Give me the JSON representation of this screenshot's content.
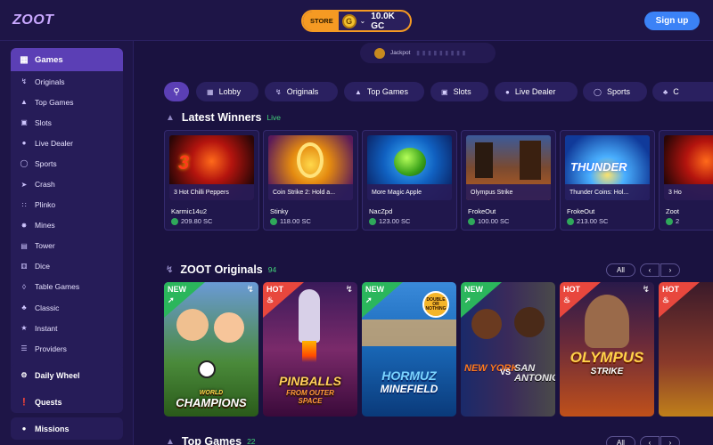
{
  "header": {
    "logo": "ZOOT",
    "store_label": "STORE",
    "coin_letter": "G",
    "balance": "10.0K GC",
    "signup_label": "Sign up"
  },
  "jackpot": {
    "label": "Jackpot"
  },
  "sidebar": {
    "games_label": "Games",
    "items": [
      {
        "label": "Originals",
        "icon": "bolt-icon"
      },
      {
        "label": "Top Games",
        "icon": "trophy-icon"
      },
      {
        "label": "Slots",
        "icon": "slots-icon"
      },
      {
        "label": "Live Dealer",
        "icon": "live-dealer-icon"
      },
      {
        "label": "Sports",
        "icon": "sports-icon"
      },
      {
        "label": "Crash",
        "icon": "rocket-icon"
      },
      {
        "label": "Plinko",
        "icon": "plinko-icon"
      },
      {
        "label": "Mines",
        "icon": "mine-icon"
      },
      {
        "label": "Tower",
        "icon": "tower-icon"
      },
      {
        "label": "Dice",
        "icon": "dice-icon"
      },
      {
        "label": "Table Games",
        "icon": "table-games-icon"
      },
      {
        "label": "Classic",
        "icon": "classic-icon"
      },
      {
        "label": "Instant",
        "icon": "instant-icon"
      },
      {
        "label": "Providers",
        "icon": "providers-icon"
      }
    ],
    "daily_wheel": "Daily Wheel",
    "quests": "Quests",
    "missions": "Missions"
  },
  "tabs": [
    {
      "label": "Lobby",
      "icon": "gamepad-icon"
    },
    {
      "label": "Originals",
      "icon": "bolt-icon"
    },
    {
      "label": "Top Games",
      "icon": "trophy-icon"
    },
    {
      "label": "Slots",
      "icon": "slots-icon"
    },
    {
      "label": "Live Dealer",
      "icon": "live-dealer-icon"
    },
    {
      "label": "Sports",
      "icon": "sports-icon"
    },
    {
      "label": "C",
      "icon": "classic-icon"
    }
  ],
  "latest_winners": {
    "title": "Latest Winners",
    "live_label": "Live",
    "cards": [
      {
        "game": "3 Hot Chilli Peppers",
        "user": "Karmic14u2",
        "amount": "209.80 SC"
      },
      {
        "game": "Coin Strike 2: Hold a...",
        "user": "Stinky",
        "amount": "118.00 SC"
      },
      {
        "game": "More Magic Apple",
        "user": "NacZpd",
        "amount": "123.00 SC"
      },
      {
        "game": "Olympus Strike",
        "user": "FrokeOut",
        "amount": "100.00 SC"
      },
      {
        "game": "Thunder Coins: Hol...",
        "user": "FrokeOut",
        "amount": "213.00 SC"
      },
      {
        "game": "3 Ho",
        "user": "Zoot",
        "amount": "2"
      }
    ]
  },
  "originals": {
    "title": "ZOOT Originals",
    "count": "94",
    "all_label": "All",
    "prev_icon": "‹",
    "next_icon": "›",
    "cards": [
      {
        "badge": "NEW",
        "title_lines": [
          "WORLD",
          "CHAMPIONS"
        ]
      },
      {
        "badge": "HOT",
        "title_lines": [
          "PINBALLS",
          "FROM OUTER SPACE"
        ]
      },
      {
        "badge": "NEW",
        "title_lines": [
          "DOUBLE OR NOTHING",
          "HORMUZ",
          "MINEFIELD"
        ]
      },
      {
        "badge": "NEW",
        "title_lines": [
          "NEW YORK",
          "VS",
          "SAN ANTONIO"
        ]
      },
      {
        "badge": "HOT",
        "title_lines": [
          "OLYMPUS",
          "STRIKE"
        ]
      },
      {
        "badge": "HOT",
        "title_lines": [
          ""
        ]
      }
    ]
  },
  "top_games": {
    "title": "Top Games",
    "count": "22",
    "all_label": "All"
  },
  "colors": {
    "background": "#1a1240",
    "accent_purple": "#5b3fb5",
    "store_orange": "#f59a23",
    "signup_blue": "#3b82f6",
    "live_green": "#42d37a",
    "badge_new": "#2bb65c",
    "badge_hot": "#e8473d"
  }
}
